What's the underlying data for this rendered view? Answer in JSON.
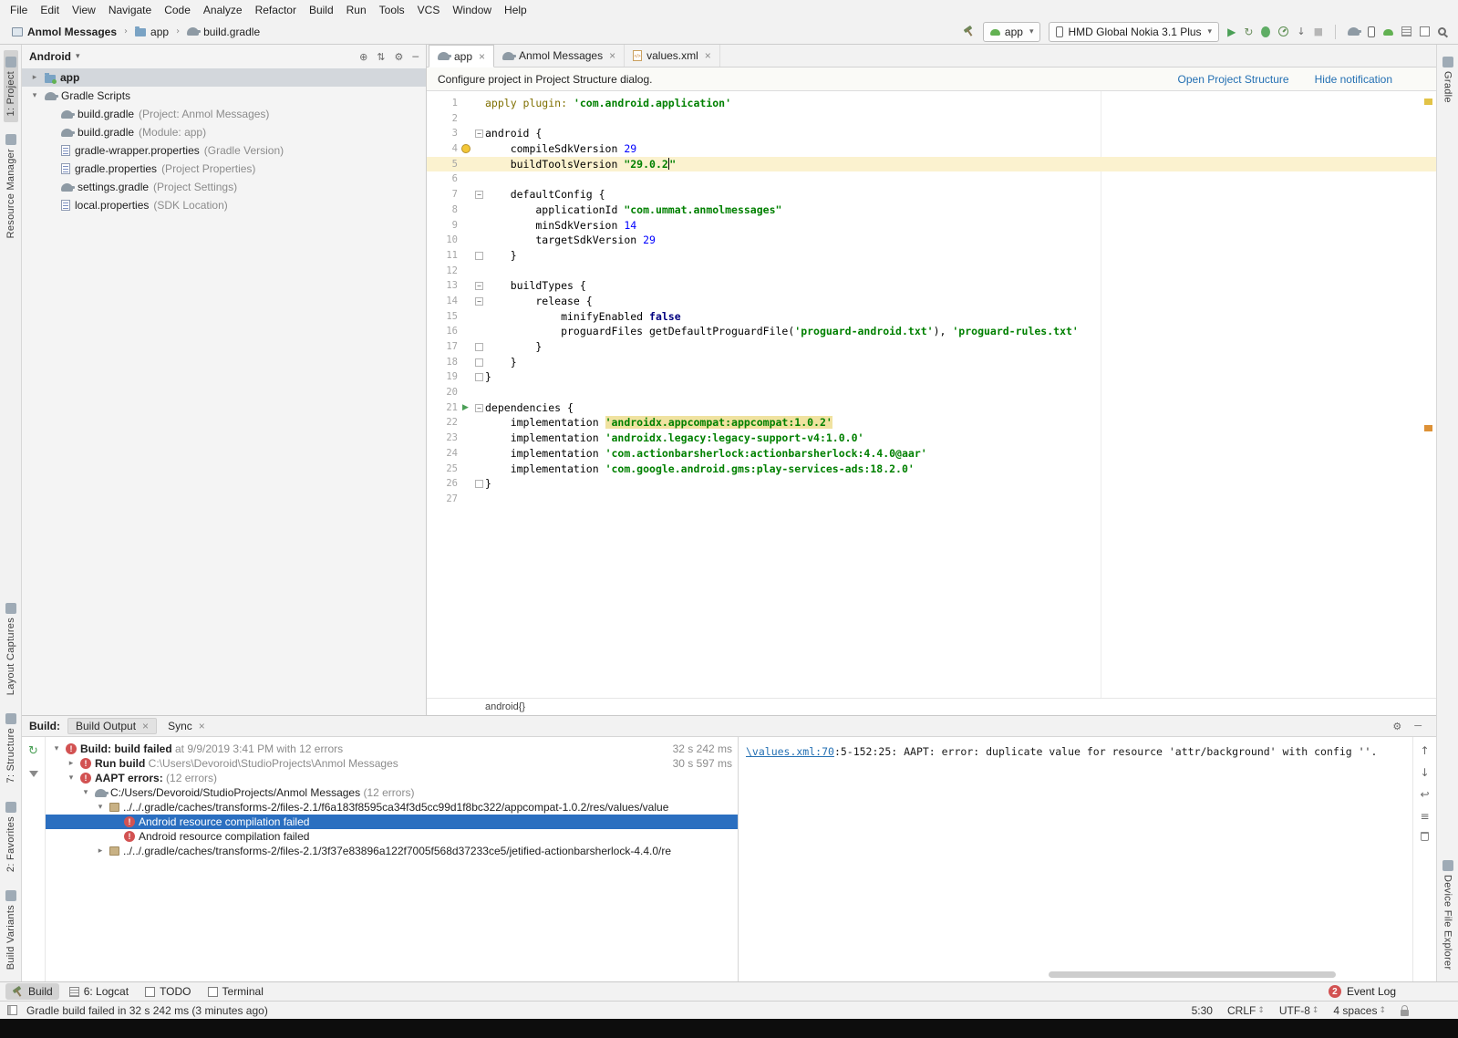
{
  "colors": {
    "selection_blue": "#2b6fc0",
    "error_red": "#d25252",
    "link_blue": "#2470b3",
    "string_green": "#008000",
    "number_blue": "#0000ff",
    "keyword_navy": "#000080",
    "caret_line_yellow": "#fbf2cf",
    "usage_highlight_yellow": "#f0e2a0"
  },
  "menu_bar": {
    "items": [
      "File",
      "Edit",
      "View",
      "Navigate",
      "Code",
      "Analyze",
      "Refactor",
      "Build",
      "Run",
      "Tools",
      "VCS",
      "Window",
      "Help"
    ]
  },
  "navigation_bar": {
    "items": [
      "Anmol Messages",
      "app",
      "build.gradle"
    ]
  },
  "run_toolbar": {
    "run_config": "app",
    "device": "HMD Global Nokia 3.1 Plus",
    "action_icons": [
      "run",
      "apply-changes",
      "debug",
      "profile",
      "attach-debugger",
      "stop"
    ],
    "tool_icons": [
      "sync-gradle",
      "avd-manager",
      "sdk-manager",
      "logcat",
      "layout-inspector",
      "search"
    ]
  },
  "left_stripe": {
    "top": [
      {
        "label": "1: Project",
        "selected": true
      },
      {
        "label": "Resource Manager",
        "selected": false
      }
    ],
    "bottom": [
      {
        "label": "Layout Captures",
        "selected": false
      },
      {
        "label": "7: Structure",
        "selected": false
      },
      {
        "label": "2: Favorites",
        "selected": false
      },
      {
        "label": "Build Variants",
        "selected": false
      }
    ]
  },
  "right_stripe": {
    "top": [
      {
        "label": "Gradle",
        "selected": false
      }
    ],
    "bottom": [
      {
        "label": "Device File Explorer",
        "selected": false
      }
    ]
  },
  "project_panel": {
    "title": "Android",
    "tree": [
      {
        "depth": 0,
        "arrow": "collapsed",
        "icon": "folder-app",
        "label": "app",
        "suffix": "",
        "bold": true,
        "selected": true
      },
      {
        "depth": 0,
        "arrow": "expanded",
        "icon": "gradle",
        "label": "Gradle Scripts",
        "suffix": "",
        "bold": false,
        "selected": false
      },
      {
        "depth": 1,
        "arrow": "none",
        "icon": "gradle",
        "label": "build.gradle",
        "suffix": " (Project: Anmol Messages)",
        "bold": false,
        "selected": false
      },
      {
        "depth": 1,
        "arrow": "none",
        "icon": "gradle",
        "label": "build.gradle",
        "suffix": " (Module: app)",
        "bold": false,
        "selected": false
      },
      {
        "depth": 1,
        "arrow": "none",
        "icon": "properties",
        "label": "gradle-wrapper.properties",
        "suffix": " (Gradle Version)",
        "bold": false,
        "selected": false
      },
      {
        "depth": 1,
        "arrow": "none",
        "icon": "properties",
        "label": "gradle.properties",
        "suffix": " (Project Properties)",
        "bold": false,
        "selected": false
      },
      {
        "depth": 1,
        "arrow": "none",
        "icon": "gradle",
        "label": "settings.gradle",
        "suffix": " (Project Settings)",
        "bold": false,
        "selected": false
      },
      {
        "depth": 1,
        "arrow": "none",
        "icon": "properties",
        "label": "local.properties",
        "suffix": " (SDK Location)",
        "bold": false,
        "selected": false
      }
    ]
  },
  "editor": {
    "tabs": [
      {
        "label": "app",
        "icon": "gradle",
        "selected": true
      },
      {
        "label": "Anmol Messages",
        "icon": "gradle",
        "selected": false
      },
      {
        "label": "values.xml",
        "icon": "xml",
        "selected": false
      }
    ],
    "notification": {
      "text": "Configure project in Project Structure dialog.",
      "actions": [
        "Open Project Structure",
        "Hide notification"
      ]
    },
    "breadcrumb": "android{}",
    "code_lines": [
      {
        "n": 1,
        "tokens": [
          [
            "apply plugin: ",
            "meta"
          ],
          [
            "'com.android.application'",
            "str"
          ]
        ]
      },
      {
        "n": 2,
        "tokens": []
      },
      {
        "n": 3,
        "fold": "open",
        "tokens": [
          [
            "android {",
            "plain"
          ]
        ]
      },
      {
        "n": 4,
        "gutter": "bulb",
        "tokens": [
          [
            "    compileSdkVersion ",
            "plain"
          ],
          [
            "29",
            "num"
          ]
        ]
      },
      {
        "n": 5,
        "current": true,
        "tokens": [
          [
            "    buildToolsVersion ",
            "plain"
          ],
          [
            "\"29.0.2",
            "str"
          ],
          [
            "",
            "caret"
          ],
          [
            "\"",
            "str"
          ]
        ]
      },
      {
        "n": 6,
        "tokens": []
      },
      {
        "n": 7,
        "fold": "open",
        "tokens": [
          [
            "    defaultConfig {",
            "plain"
          ]
        ]
      },
      {
        "n": 8,
        "tokens": [
          [
            "        applicationId ",
            "plain"
          ],
          [
            "\"com.ummat.anmolmessages\"",
            "str"
          ]
        ]
      },
      {
        "n": 9,
        "tokens": [
          [
            "        minSdkVersion ",
            "plain"
          ],
          [
            "14",
            "num"
          ]
        ]
      },
      {
        "n": 10,
        "tokens": [
          [
            "        targetSdkVersion ",
            "plain"
          ],
          [
            "29",
            "num"
          ]
        ]
      },
      {
        "n": 11,
        "fold": "end",
        "tokens": [
          [
            "    }",
            "plain"
          ]
        ]
      },
      {
        "n": 12,
        "tokens": []
      },
      {
        "n": 13,
        "fold": "open",
        "tokens": [
          [
            "    buildTypes {",
            "plain"
          ]
        ]
      },
      {
        "n": 14,
        "fold": "open",
        "tokens": [
          [
            "        release {",
            "plain"
          ]
        ]
      },
      {
        "n": 15,
        "tokens": [
          [
            "            minifyEnabled ",
            "plain"
          ],
          [
            "false",
            "kw"
          ]
        ]
      },
      {
        "n": 16,
        "tokens": [
          [
            "            proguardFiles getDefaultProguardFile(",
            "plain"
          ],
          [
            "'proguard-android.txt'",
            "str"
          ],
          [
            "), ",
            "plain"
          ],
          [
            "'proguard-rules.txt'",
            "str"
          ]
        ]
      },
      {
        "n": 17,
        "fold": "end",
        "tokens": [
          [
            "        }",
            "plain"
          ]
        ]
      },
      {
        "n": 18,
        "fold": "end",
        "tokens": [
          [
            "    }",
            "plain"
          ]
        ]
      },
      {
        "n": 19,
        "fold": "end",
        "tokens": [
          [
            "}",
            "plain"
          ]
        ]
      },
      {
        "n": 20,
        "tokens": []
      },
      {
        "n": 21,
        "fold": "open",
        "gutter": "run",
        "tokens": [
          [
            "dependencies {",
            "plain"
          ]
        ]
      },
      {
        "n": 22,
        "tokens": [
          [
            "    implementation ",
            "plain"
          ],
          [
            "'androidx.appcompat:appcompat:1.0.2'",
            "strhl"
          ]
        ]
      },
      {
        "n": 23,
        "tokens": [
          [
            "    implementation ",
            "plain"
          ],
          [
            "'androidx.legacy:legacy-support-v4:1.0.0'",
            "str"
          ]
        ]
      },
      {
        "n": 24,
        "tokens": [
          [
            "    implementation ",
            "plain"
          ],
          [
            "'com.actionbarsherlock:actionbarsherlock:4.4.0@aar'",
            "str"
          ]
        ]
      },
      {
        "n": 25,
        "tokens": [
          [
            "    implementation ",
            "plain"
          ],
          [
            "'com.google.android.gms:play-services-ads:18.2.0'",
            "str"
          ]
        ]
      },
      {
        "n": 26,
        "fold": "end",
        "tokens": [
          [
            "}",
            "plain"
          ]
        ]
      },
      {
        "n": 27,
        "tokens": []
      }
    ]
  },
  "build_panel": {
    "title": "Build:",
    "tabs": [
      {
        "label": "Build Output",
        "selected": true
      },
      {
        "label": "Sync",
        "selected": false
      }
    ],
    "tree": [
      {
        "depth": 0,
        "arrow": "expanded",
        "icon": "error",
        "selected": false,
        "duration": "32 s 242 ms",
        "segments": [
          {
            "t": "Build: build failed",
            "s": "b"
          },
          {
            "t": " at 9/9/2019 3:41 PM  with 12 errors",
            "s": "g"
          }
        ]
      },
      {
        "depth": 1,
        "arrow": "collapsed",
        "icon": "error",
        "selected": false,
        "duration": "30 s 597 ms",
        "segments": [
          {
            "t": "Run build ",
            "s": "b"
          },
          {
            "t": "C:\\Users\\Devoroid\\StudioProjects\\Anmol Messages",
            "s": "g"
          }
        ]
      },
      {
        "depth": 1,
        "arrow": "expanded",
        "icon": "error",
        "selected": false,
        "duration": "",
        "segments": [
          {
            "t": "AAPT errors: ",
            "s": "b"
          },
          {
            "t": "(12 errors)",
            "s": "g"
          }
        ]
      },
      {
        "depth": 2,
        "arrow": "expanded",
        "icon": "gradle",
        "selected": false,
        "duration": "",
        "segments": [
          {
            "t": "C:/Users/Devoroid/StudioProjects/Anmol Messages ",
            "s": "p"
          },
          {
            "t": "(12 errors)",
            "s": "g"
          }
        ]
      },
      {
        "depth": 3,
        "arrow": "expanded",
        "icon": "package",
        "selected": false,
        "duration": "",
        "segments": [
          {
            "t": "../../.gradle/caches/transforms-2/files-2.1/f6a183f8595ca34f3d5cc99d1f8bc322/appcompat-1.0.2/res/values/value",
            "s": "p"
          }
        ]
      },
      {
        "depth": 4,
        "arrow": "none",
        "icon": "error",
        "selected": true,
        "duration": "",
        "segments": [
          {
            "t": "Android resource compilation failed",
            "s": "p"
          }
        ]
      },
      {
        "depth": 4,
        "arrow": "none",
        "icon": "error",
        "selected": false,
        "duration": "",
        "segments": [
          {
            "t": "Android resource compilation failed",
            "s": "p"
          }
        ]
      },
      {
        "depth": 3,
        "arrow": "collapsed",
        "icon": "package",
        "selected": false,
        "duration": "",
        "segments": [
          {
            "t": "../../.gradle/caches/transforms-2/files-2.1/3f37e83896a122f7005f568d37233ce5/jetified-actionbarsherlock-4.4.0/re",
            "s": "p"
          }
        ]
      }
    ],
    "console": {
      "link": "\\values.xml:70",
      "text": ":5-152:25: AAPT: error: duplicate value for resource 'attr/background' with config ''."
    }
  },
  "bottom_bar": {
    "left": [
      {
        "label": "Build",
        "icon": "hammer",
        "selected": true
      },
      {
        "label": "6: Logcat",
        "icon": "logcat",
        "selected": false
      },
      {
        "label": "TODO",
        "icon": "todo",
        "selected": false
      },
      {
        "label": "Terminal",
        "icon": "terminal",
        "selected": false
      }
    ],
    "event_log": {
      "label": "Event Log",
      "badge": "2"
    }
  },
  "status_bar": {
    "message": "Gradle build failed in 32 s 242 ms (3 minutes ago)",
    "caret_position": "5:30",
    "line_separator": "CRLF",
    "encoding": "UTF-8",
    "indent": "4 spaces"
  }
}
